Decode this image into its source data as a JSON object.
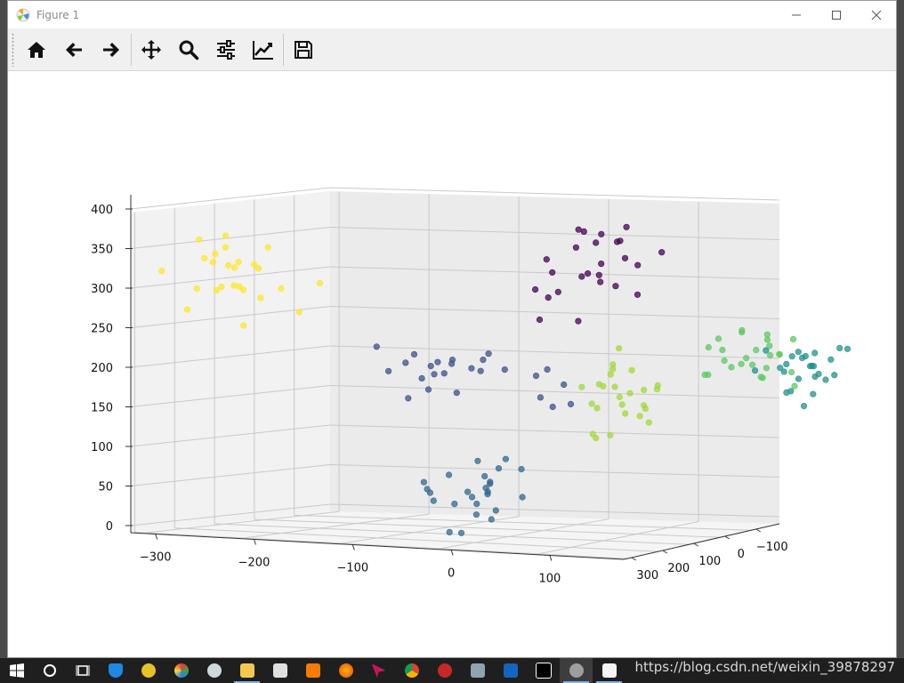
{
  "window": {
    "title": "Figure 1"
  },
  "toolbar": {
    "buttons": [
      {
        "name": "home-button",
        "icon": "home-icon"
      },
      {
        "name": "back-button",
        "icon": "arrow-left-icon"
      },
      {
        "name": "forward-button",
        "icon": "arrow-right-icon"
      },
      {
        "name": "pan-button",
        "icon": "move-icon"
      },
      {
        "name": "zoom-button",
        "icon": "magnifier-icon"
      },
      {
        "name": "configure-subplots-button",
        "icon": "sliders-icon"
      },
      {
        "name": "edit-axis-button",
        "icon": "line-chart-icon"
      },
      {
        "name": "save-button",
        "icon": "floppy-disk-icon"
      }
    ]
  },
  "taskbar": {
    "watermark": "https://blog.csdn.net/weixin_39878297"
  },
  "colors": {
    "c0": "#440154",
    "c1": "#3b528b",
    "c2": "#31688e",
    "c3": "#21918c",
    "c4": "#5ec962",
    "c5": "#a0da39",
    "c6": "#fde725"
  },
  "chart_data": {
    "type": "scatter",
    "projection": "3d",
    "x_ticks": [
      "−300",
      "−200",
      "−100",
      "0",
      "100"
    ],
    "y_ticks": [
      "300",
      "200",
      "100",
      "0",
      "−100"
    ],
    "z_ticks": [
      "0",
      "50",
      "100",
      "150",
      "200",
      "250",
      "300",
      "350",
      "400"
    ],
    "xlim": [
      -300,
      100
    ],
    "ylim": [
      -100,
      300
    ],
    "zlim": [
      0,
      400
    ],
    "clusters": [
      {
        "color": "#fde725",
        "center": [
          -260,
          0,
          310
        ],
        "spread": [
          25,
          20,
          20
        ],
        "count": 25
      },
      {
        "color": "#440154",
        "center": [
          40,
          0,
          340
        ],
        "spread": [
          25,
          20,
          30
        ],
        "count": 25
      },
      {
        "color": "#3b528b",
        "center": [
          -50,
          0,
          200
        ],
        "spread": [
          35,
          20,
          15
        ],
        "count": 25
      },
      {
        "color": "#a0da39",
        "center": [
          60,
          0,
          190
        ],
        "spread": [
          20,
          20,
          25
        ],
        "count": 25
      },
      {
        "color": "#5ec962",
        "center": [
          150,
          80,
          230
        ],
        "spread": [
          20,
          20,
          20
        ],
        "count": 25
      },
      {
        "color": "#21918c",
        "center": [
          160,
          170,
          200
        ],
        "spread": [
          20,
          20,
          20
        ],
        "count": 25
      },
      {
        "color": "#31688e",
        "center": [
          -50,
          0,
          50
        ],
        "spread": [
          25,
          20,
          20
        ],
        "count": 25
      }
    ]
  }
}
